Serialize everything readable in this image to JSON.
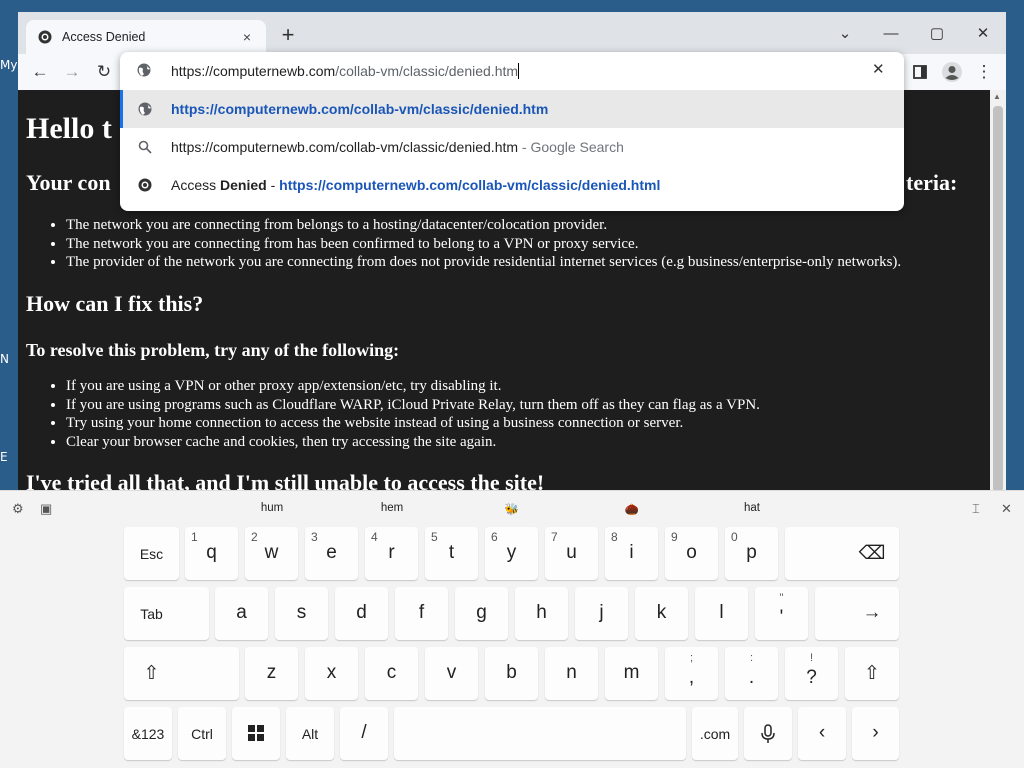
{
  "desktop": {
    "frag1": "My",
    "frag2": "N",
    "frag3": "E"
  },
  "browser": {
    "tab_title": "Access Denied",
    "tab_close": "×",
    "new_tab": "+",
    "window_controls": {
      "dropdown": "⌄",
      "minimize": "—",
      "maximize": "▢",
      "close": "✕"
    },
    "nav": {
      "back": "←",
      "forward": "→",
      "reload": "↻",
      "menu": "⋮"
    }
  },
  "omnibox": {
    "input_host": "https://computernewb.com",
    "input_path": "/collab-vm/classic/denied.htm",
    "clear": "✕",
    "suggestions": [
      {
        "text": "https://computernewb.com/collab-vm/classic/denied.htm",
        "icon": "globe-icon"
      },
      {
        "text": "https://computernewb.com/collab-vm/classic/denied.htm",
        "suffix": " - Google Search",
        "icon": "search-icon"
      },
      {
        "prefix": "Access ",
        "bold": "Denied",
        "sep": " - ",
        "url": "https://computernewb.com/collab-vm/classic/denied.html",
        "icon": "site-icon"
      }
    ]
  },
  "page": {
    "heading": "Hello t",
    "cause_heading": "Your con",
    "cause_tail": "teria:",
    "reasons": [
      "The network you are connecting from belongs to a hosting/datacenter/colocation provider.",
      "The network you are connecting from has been confirmed to belong to a VPN or proxy service.",
      "The provider of the network you are connecting from does not provide residential internet services (e.g business/enterprise-only networks)."
    ],
    "fix_heading": "How can I fix this?",
    "resolve_heading": "To resolve this problem, try any of the following:",
    "fixes": [
      "If you are using a VPN or other proxy app/extension/etc, try disabling it.",
      "If you are using programs such as Cloudflare WARP, iCloud Private Relay, turn them off as they can flag as a VPN.",
      "Try using your home connection to access the website instead of using a business connection or server.",
      "Clear your browser cache and cookies, then try accessing the site again."
    ],
    "tried_heading": "I've tried all that, and I'm still unable to access the site!"
  },
  "keyboard": {
    "predictions": [
      "hum",
      "hem",
      "🐝",
      "🌰",
      "hat"
    ],
    "row1": [
      {
        "main": "Esc"
      },
      {
        "main": "q",
        "sub": "1"
      },
      {
        "main": "w",
        "sub": "2"
      },
      {
        "main": "e",
        "sub": "3"
      },
      {
        "main": "r",
        "sub": "4"
      },
      {
        "main": "t",
        "sub": "5"
      },
      {
        "main": "y",
        "sub": "6"
      },
      {
        "main": "u",
        "sub": "7"
      },
      {
        "main": "i",
        "sub": "8"
      },
      {
        "main": "o",
        "sub": "9"
      },
      {
        "main": "p",
        "sub": "0"
      }
    ],
    "backspace": "⌫",
    "row2": [
      "Tab",
      "a",
      "s",
      "d",
      "f",
      "g",
      "h",
      "j",
      "k",
      "l"
    ],
    "quote_top": "\"",
    "quote_bot": "'",
    "enter": "→",
    "row3": [
      "z",
      "x",
      "c",
      "v",
      "b",
      "n",
      "m"
    ],
    "comma_top": ";",
    "comma_bot": ",",
    "period_top": ":",
    "period_bot": ".",
    "question_top": "!",
    "question_bot": "?",
    "shift": "⇧",
    "row4": {
      "sym": "&123",
      "ctrl": "Ctrl",
      "alt": "Alt",
      "slash": "/",
      "dotcom": ".com",
      "mic": "🎙",
      "left": "‹",
      "right": "›"
    }
  }
}
